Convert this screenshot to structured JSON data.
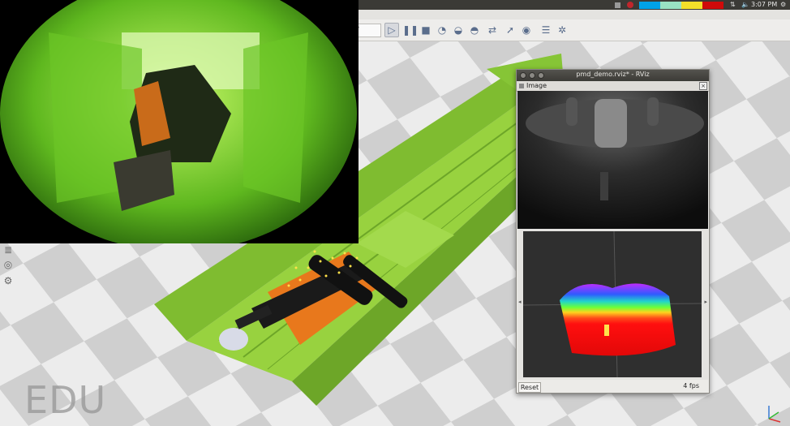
{
  "top_panel": {
    "time": "3:07 PM",
    "color_blocks": [
      "#00a2e8",
      "#99e2c4",
      "#f4e02a",
      "#cf0a0a"
    ]
  },
  "rviz_window": {
    "title": "pmd_demo.rviz* - RViz",
    "panel_title": "Image",
    "reset_label": "Reset",
    "fps_label": "4 fps"
  },
  "watermark": "EDU",
  "colors": {
    "floor_light": "#f1f1f1",
    "floor_dark": "#c9c9c9",
    "track_green": "#8ccf35",
    "robot_orange": "#e87b1e"
  }
}
